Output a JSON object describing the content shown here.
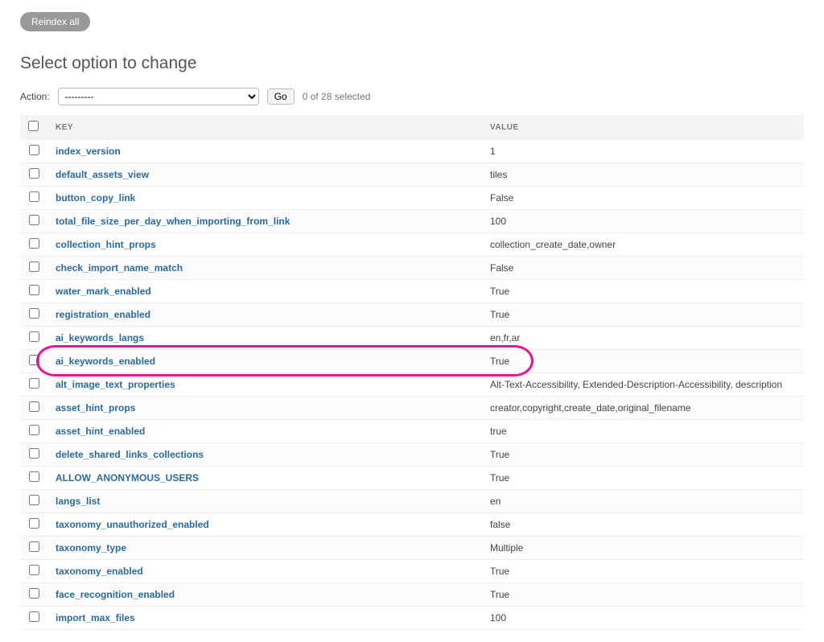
{
  "toolbar": {
    "reindex_label": "Reindex all"
  },
  "heading": "Select option to change",
  "action": {
    "label": "Action:",
    "placeholder": "---------",
    "go_label": "Go",
    "selection_status": "0 of 28 selected"
  },
  "columns": {
    "key": "KEY",
    "value": "VALUE"
  },
  "highlight_row_index": 9,
  "rows": [
    {
      "key": "index_version",
      "value": "1"
    },
    {
      "key": "default_assets_view",
      "value": "tiles"
    },
    {
      "key": "button_copy_link",
      "value": "False"
    },
    {
      "key": "total_file_size_per_day_when_importing_from_link",
      "value": "100"
    },
    {
      "key": "collection_hint_props",
      "value": "collection_create_date,owner"
    },
    {
      "key": "check_import_name_match",
      "value": "False"
    },
    {
      "key": "water_mark_enabled",
      "value": "True"
    },
    {
      "key": "registration_enabled",
      "value": "True"
    },
    {
      "key": "ai_keywords_langs",
      "value": "en,fr,ar"
    },
    {
      "key": "ai_keywords_enabled",
      "value": "True"
    },
    {
      "key": "alt_image_text_properties",
      "value": "Alt-Text-Accessibility, Extended-Description-Accessibility, description"
    },
    {
      "key": "asset_hint_props",
      "value": "creator,copyright,create_date,original_filename"
    },
    {
      "key": "asset_hint_enabled",
      "value": "true"
    },
    {
      "key": "delete_shared_links_collections",
      "value": "True"
    },
    {
      "key": "ALLOW_ANONYMOUS_USERS",
      "value": "True"
    },
    {
      "key": "langs_list",
      "value": "en"
    },
    {
      "key": "taxonomy_unauthorized_enabled",
      "value": "false"
    },
    {
      "key": "taxonomy_type",
      "value": "Multiple"
    },
    {
      "key": "taxonomy_enabled",
      "value": "True"
    },
    {
      "key": "face_recognition_enabled",
      "value": "True"
    },
    {
      "key": "import_max_files",
      "value": "100"
    }
  ]
}
